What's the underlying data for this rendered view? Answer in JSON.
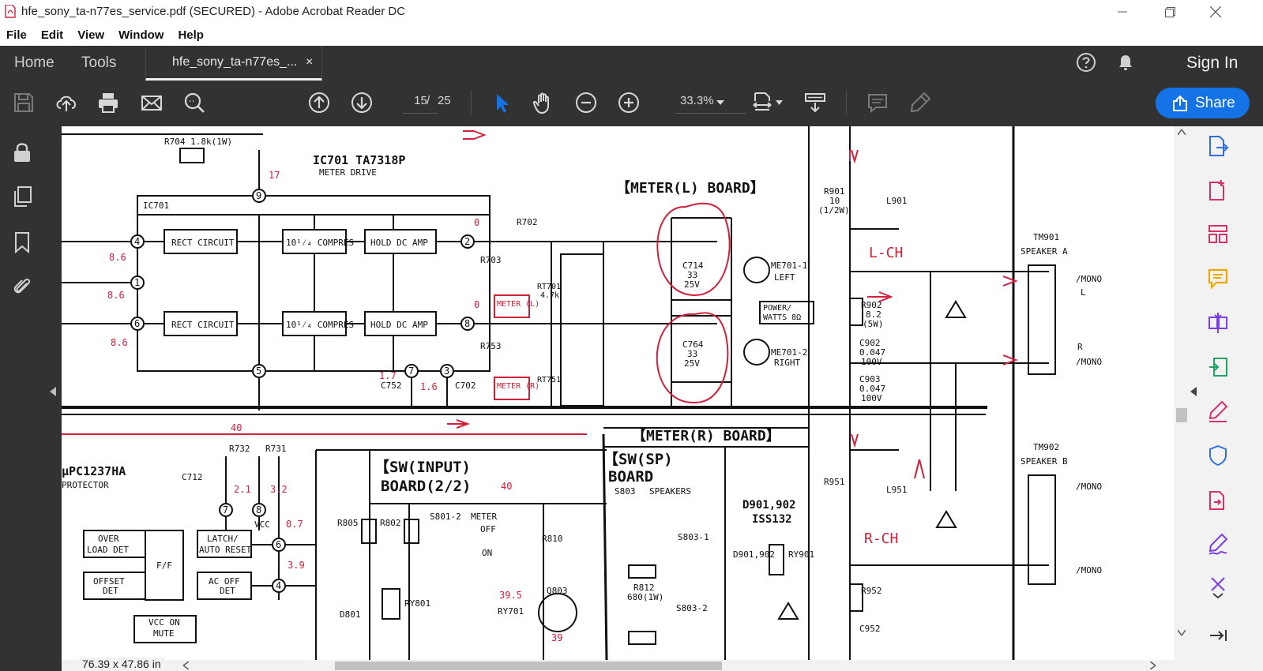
{
  "window": {
    "title": "hfe_sony_ta-n77es_service.pdf (SECURED) - Adobe Acrobat Reader DC",
    "minimize_icon": "minimize-icon",
    "maximize_icon": "restore-icon",
    "close_icon": "close-icon"
  },
  "menu": {
    "items": [
      "File",
      "Edit",
      "View",
      "Window",
      "Help"
    ]
  },
  "tabs": {
    "home": "Home",
    "tools": "Tools",
    "document_tab": "hfe_sony_ta-n77es_...",
    "close_glyph": "×",
    "sign_in": "Sign In"
  },
  "toolbar": {
    "current_page": "15",
    "page_separator": "/",
    "total_pages": "25",
    "zoom": "33.3%",
    "share_label": "Share"
  },
  "status": {
    "page_size": "76.39 x 47.86 in"
  },
  "schematic": {
    "labels": {
      "ic701": "IC701  TA7318P",
      "meter_drive": "METER DRIVE",
      "ic701_box": "IC701",
      "meter_l_board": "【METER(L) BOARD】",
      "meter_r_board": "【METER(R) BOARD】",
      "rect_circuit": "RECT CIRCUIT",
      "compres": "10¹⁄₄ COMPRES",
      "hold_dc_amp": "HOLD DC AMP",
      "r704": "R704  1.8k(1W)",
      "r702": "R702",
      "r703": "R703",
      "rt701": "RT701",
      "rt701v": "4.7k",
      "r753": "R753",
      "rt751": "RT751",
      "meter_l": "METER (L)",
      "meter_r": "METER (R)",
      "c714": "C714",
      "c714v": "33",
      "c714u": "25V",
      "c764": "C764",
      "me7011": "ME701-1",
      "left": "LEFT",
      "me7012": "ME701-2",
      "right": "RIGHT",
      "power_watts": "POWER/",
      "watts": "WATTS 8Ω",
      "r901": "R901",
      "r901v": "10",
      "r901u": "(1/2W)",
      "l901": "L901",
      "lch": "L-CH",
      "rch": "R-CH",
      "r902": "R902",
      "r902v": "8.2",
      "r902u": "(5W)",
      "c902": "C902",
      "c902v": "0.047",
      "c902u": "100V",
      "c903": "C903",
      "tm901": "TM901",
      "speaker_a": "SPEAKER A",
      "tm902": "TM902",
      "speaker_b": "SPEAKER B",
      "mono": "/MONO",
      "r_label": "R",
      "l_label": "L",
      "r951": "R951",
      "l951": "L951",
      "r952": "R952",
      "c952": "C952",
      "sw_input": "【SW(INPUT)",
      "sw_input2": "BOARD(2/2)",
      "sw_sp": "【SW(SP)",
      "sw_sp2": "BOARD",
      "s803": "S803",
      "speakers": "SPEAKERS",
      "s8012": "S801-2",
      "meter": "METER",
      "off": "OFF",
      "on": "ON",
      "upc": "μPC1237HA",
      "protector": "PROTECTOR",
      "over_load": "OVER",
      "load_det": "LOAD DET",
      "offset": "OFFSET",
      "det": "DET",
      "ff": "F/F",
      "latch": "LATCH/",
      "auto_reset": "AUTO RESET",
      "ac_off": "AC OFF",
      "vcc_on": "VCC ON",
      "mute": "MUTE",
      "vcc": "VCC",
      "d901": "D901,902",
      "iss132": "ISS132",
      "ry901": "RY901",
      "r810": "R810",
      "q803": "Q803",
      "ry801": "RY801",
      "d801": "D801",
      "ry701": "RY701",
      "r812": "R812",
      "r812v": "680(1W)",
      "s8031": "S803-1",
      "s8032": "S803-2",
      "r805": "R805",
      "r802": "R802",
      "c712": "C712",
      "r732": "R732",
      "r731": "R731",
      "c752": "C752",
      "c702": "C702"
    },
    "values": {
      "v17": "17",
      "v0a": "0",
      "v0b": "0",
      "v86a": "8.6",
      "v86b": "8.6",
      "v86c": "8.6",
      "v17b": "1.7",
      "v16": "1.6",
      "v40a": "40",
      "v40b": "40",
      "v21": "2.1",
      "v32": "3.2",
      "v07": "0.7",
      "v39": "3.9",
      "v395": "39.5",
      "v39b": "39"
    }
  },
  "colors": {
    "chrome_dark": "#323232",
    "accent": "#1473e6",
    "tool_pink": "#d6336c",
    "tool_blue": "#2f6fde",
    "tool_purple": "#7b3fe4",
    "tool_yellow": "#e8a900",
    "tool_green": "#21a366",
    "schematic_red": "#d0203a"
  }
}
